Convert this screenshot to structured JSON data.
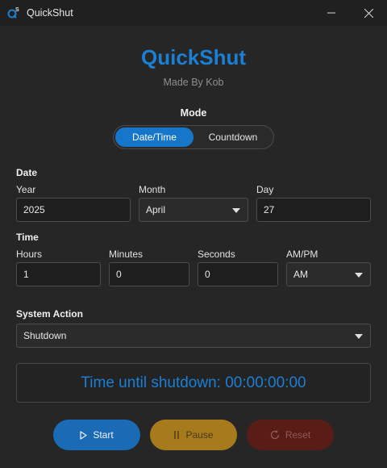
{
  "window": {
    "title": "QuickShut"
  },
  "header": {
    "app_name": "QuickShut",
    "byline": "Made By Kob"
  },
  "mode": {
    "label": "Mode",
    "options": [
      "Date/Time",
      "Countdown"
    ],
    "selected": "Date/Time"
  },
  "date": {
    "section_label": "Date",
    "year_label": "Year",
    "year_value": "2025",
    "month_label": "Month",
    "month_value": "April",
    "day_label": "Day",
    "day_value": "27"
  },
  "time": {
    "section_label": "Time",
    "hours_label": "Hours",
    "hours_value": "1",
    "minutes_label": "Minutes",
    "minutes_value": "0",
    "seconds_label": "Seconds",
    "seconds_value": "0",
    "ampm_label": "AM/PM",
    "ampm_value": "AM"
  },
  "system_action": {
    "label": "System Action",
    "value": "Shutdown"
  },
  "status": {
    "countdown_text": "Time until shutdown: 00:00:00:00"
  },
  "buttons": {
    "start": "Start",
    "pause": "Pause",
    "reset": "Reset"
  },
  "colors": {
    "accent": "#1b7fd4",
    "start": "#1a6ab5",
    "pause": "#a77a1e",
    "reset": "#5a1c17"
  },
  "icons": {
    "app": "quickshut-logo-icon",
    "start": "play-icon",
    "pause": "pause-icon",
    "reset": "refresh-icon"
  }
}
